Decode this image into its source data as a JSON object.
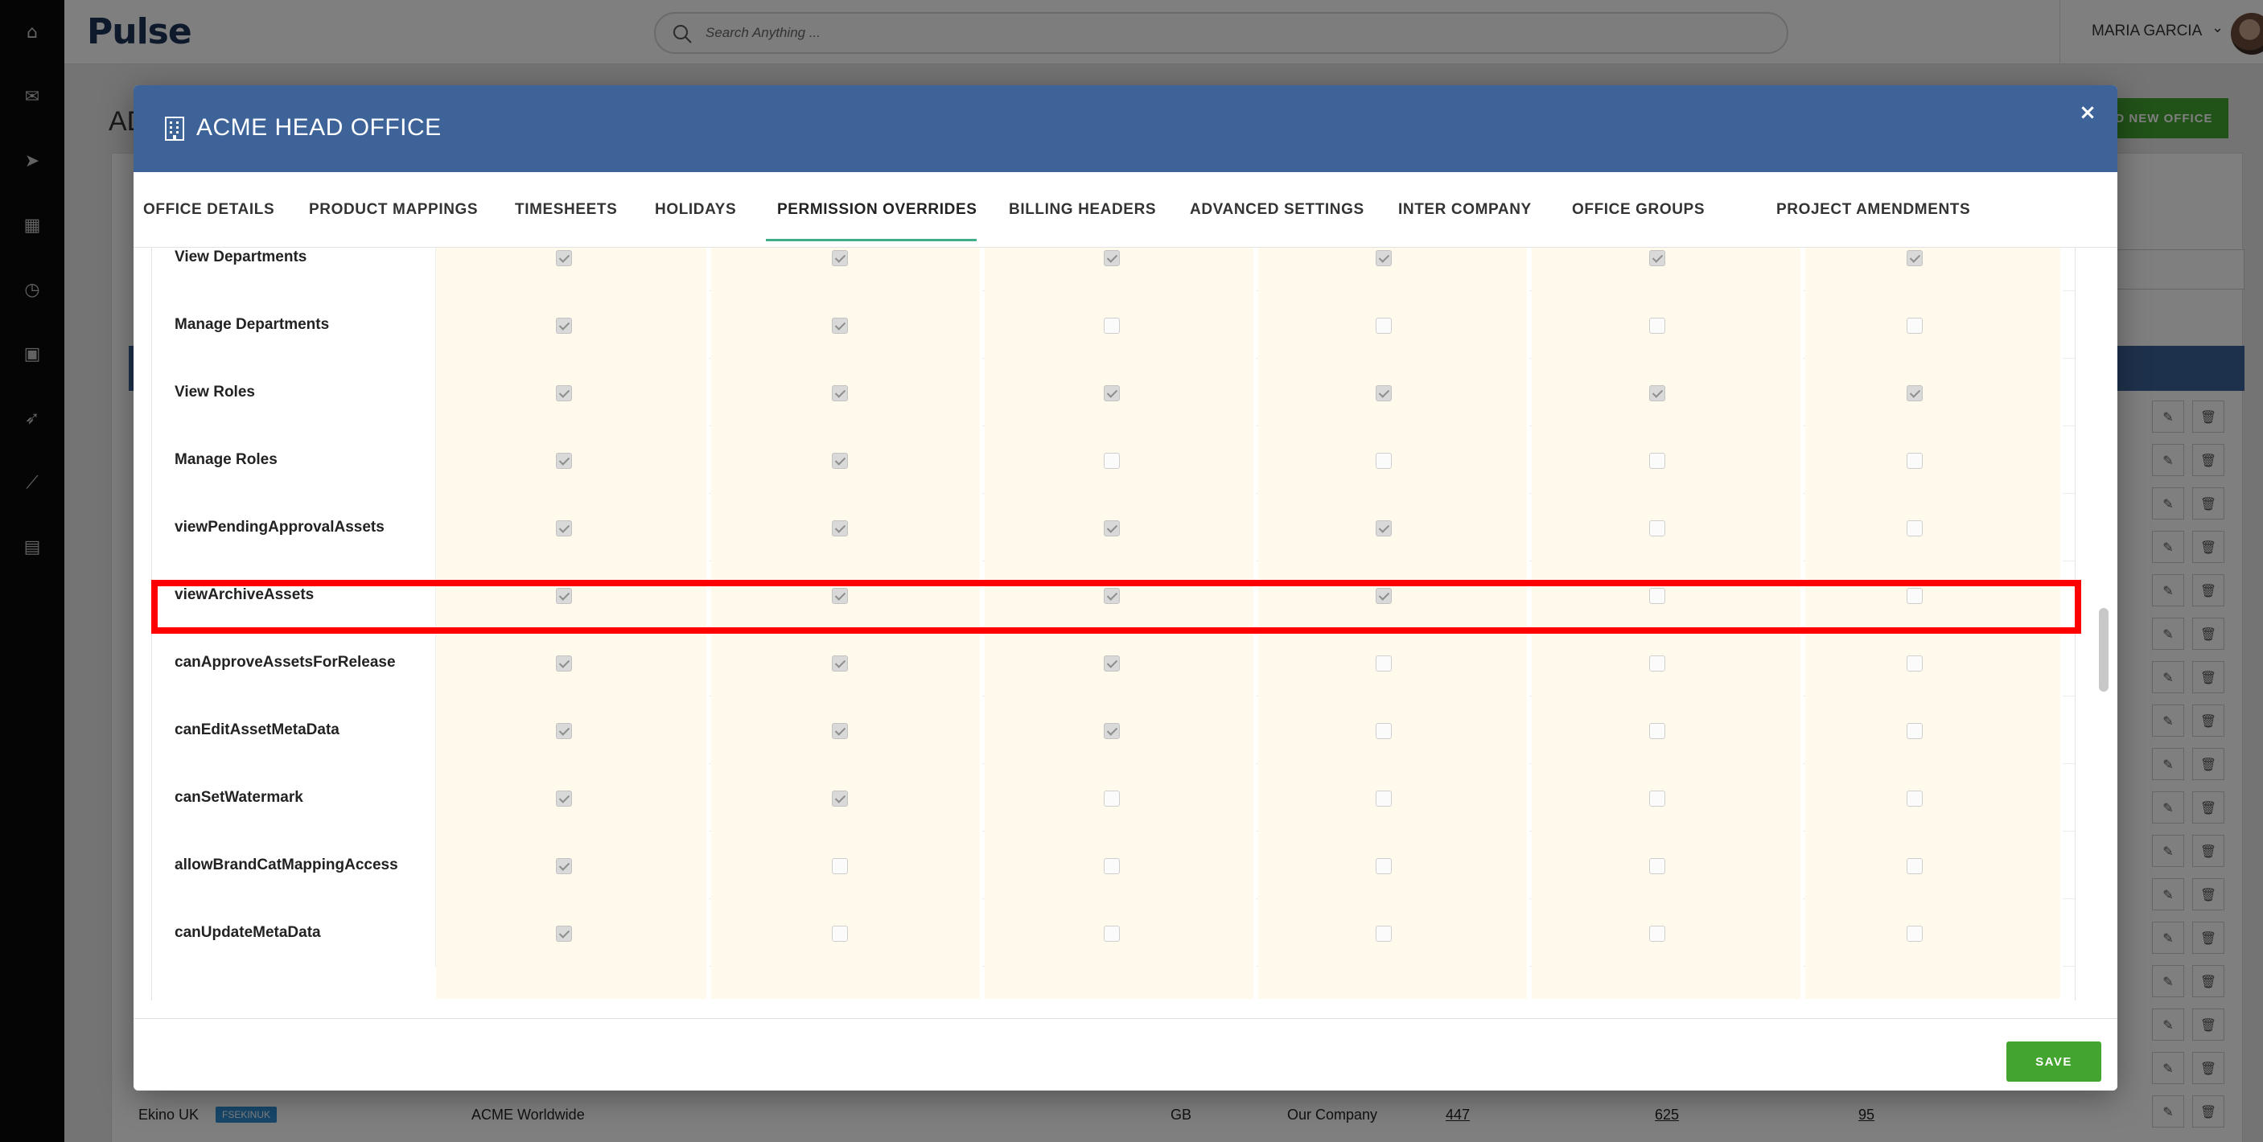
{
  "app": {
    "logo": "Pulse"
  },
  "rail": {
    "icons": [
      "home-icon",
      "mail-icon",
      "send-icon",
      "calendar-icon",
      "clock-icon",
      "image-icon",
      "rocket-icon",
      "chart-icon",
      "book-icon"
    ]
  },
  "header": {
    "search_placeholder": "Search Anything ...",
    "user_name": "MARIA GARCIA"
  },
  "background": {
    "title": "AD",
    "add_button": "D NEW OFFICE",
    "row": {
      "name": "Ekino UK",
      "badge": "FSEKINUK",
      "company": "ACME Worldwide",
      "country": "GB",
      "owner": "Our Company",
      "n1": "447",
      "n2": "625",
      "n3": "95"
    }
  },
  "modal": {
    "title": "ACME HEAD OFFICE",
    "close": "×",
    "tabs": [
      {
        "label": "OFFICE DETAILS"
      },
      {
        "label": "PRODUCT MAPPINGS"
      },
      {
        "label": "TIMESHEETS"
      },
      {
        "label": "HOLIDAYS"
      },
      {
        "label": "PERMISSION OVERRIDES",
        "active": true
      },
      {
        "label": "BILLING HEADERS"
      },
      {
        "label": "ADVANCED SETTINGS"
      },
      {
        "label": "INTER COMPANY"
      },
      {
        "label": "OFFICE GROUPS"
      },
      {
        "label": "PROJECT AMENDMENTS"
      }
    ],
    "permissions": [
      {
        "name": "View Departments",
        "checks": [
          true,
          true,
          true,
          true,
          true,
          true
        ]
      },
      {
        "name": "Manage Departments",
        "checks": [
          true,
          true,
          false,
          false,
          false,
          false
        ]
      },
      {
        "name": "View Roles",
        "checks": [
          true,
          true,
          true,
          true,
          true,
          true
        ]
      },
      {
        "name": "Manage Roles",
        "checks": [
          true,
          true,
          false,
          false,
          false,
          false
        ]
      },
      {
        "name": "viewPendingApprovalAssets",
        "checks": [
          true,
          true,
          true,
          true,
          false,
          false
        ]
      },
      {
        "name": "viewArchiveAssets",
        "checks": [
          true,
          true,
          true,
          true,
          false,
          false
        ],
        "highlighted": true
      },
      {
        "name": "canApproveAssetsForRelease",
        "checks": [
          true,
          true,
          true,
          false,
          false,
          false
        ]
      },
      {
        "name": "canEditAssetMetaData",
        "checks": [
          true,
          true,
          true,
          false,
          false,
          false
        ]
      },
      {
        "name": "canSetWatermark",
        "checks": [
          true,
          true,
          false,
          false,
          false,
          false
        ]
      },
      {
        "name": "allowBrandCatMappingAccess",
        "checks": [
          true,
          false,
          false,
          false,
          false,
          false
        ]
      },
      {
        "name": "canUpdateMetaData",
        "checks": [
          true,
          false,
          false,
          false,
          false,
          false
        ]
      }
    ],
    "save_label": "SAVE"
  },
  "colors": {
    "header_blue": "#3d6398",
    "save_green": "#43a430",
    "tab_underline": "#3fae88",
    "highlight_red": "#ff0000",
    "cell_bg": "#fffaec"
  }
}
